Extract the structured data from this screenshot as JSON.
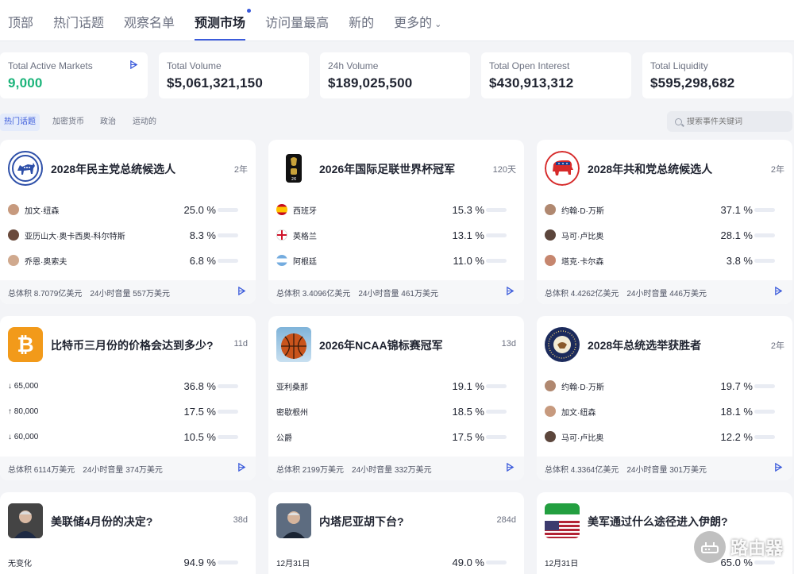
{
  "nav": {
    "tabs": [
      {
        "label": "顶部"
      },
      {
        "label": "热门话题"
      },
      {
        "label": "观察名单"
      },
      {
        "label": "预测市场",
        "active": true
      },
      {
        "label": "访问量最高"
      },
      {
        "label": "新的"
      },
      {
        "label": "更多的"
      }
    ],
    "more_icon": "chevron-down-icon"
  },
  "stats": [
    {
      "label": "Total Active Markets",
      "value": "9,000",
      "icon": "share-icon"
    },
    {
      "label": "Total Volume",
      "value": "$5,061,321,150"
    },
    {
      "label": "24h Volume",
      "value": "$189,025,500"
    },
    {
      "label": "Total Open Interest",
      "value": "$430,913,312"
    },
    {
      "label": "Total Liquidity",
      "value": "$595,298,682"
    }
  ],
  "filters": {
    "chips": [
      "热门话题",
      "加密货币",
      "政治",
      "运动的"
    ],
    "search_placeholder": "搜索事件关键词"
  },
  "colors": {
    "accent": "#3b5bdb",
    "green": "#1bb47a",
    "democrat": "#2d4fa8",
    "republican": "#d62a2a",
    "bitcoin": "#f29a1a"
  },
  "cards": [
    {
      "title": "2028年民主党总统候选人",
      "time": "2年",
      "icon": "donkey-icon",
      "rows": [
        {
          "name": "加文·纽森",
          "pct": "25.0 %",
          "value": 25.0
        },
        {
          "name": "亚历山大·奥卡西奥-科尔特斯",
          "pct": "8.3 %",
          "value": 8.3
        },
        {
          "name": "乔恩·奥索夫",
          "pct": "6.8 %",
          "value": 6.8
        }
      ],
      "foot": {
        "volume": "总体积 8.7079亿美元",
        "vol24": "24小时音量 557万美元"
      }
    },
    {
      "title": "2026年国际足联世界杯冠军",
      "time": "120天",
      "icon": "fifa-cup-icon",
      "rows": [
        {
          "name": "西班牙",
          "pct": "15.3 %",
          "value": 15.3
        },
        {
          "name": "英格兰",
          "pct": "13.1 %",
          "value": 13.1
        },
        {
          "name": "阿根廷",
          "pct": "11.0 %",
          "value": 11.0
        }
      ],
      "foot": {
        "volume": "总体积 3.4096亿美元",
        "vol24": "24小时音量 461万美元"
      }
    },
    {
      "title": "2028年共和党总统候选人",
      "time": "2年",
      "icon": "elephant-icon",
      "rows": [
        {
          "name": "约翰·D·万斯",
          "pct": "37.1 %",
          "value": 37.1
        },
        {
          "name": "马可·卢比奥",
          "pct": "28.1 %",
          "value": 28.1
        },
        {
          "name": "塔克·卡尔森",
          "pct": "3.8 %",
          "value": 3.8
        }
      ],
      "foot": {
        "volume": "总体积 4.4262亿美元",
        "vol24": "24小时音量 446万美元"
      }
    },
    {
      "title": "比特币三月份的价格会达到多少?",
      "time": "11d",
      "icon": "bitcoin-icon",
      "rows": [
        {
          "name": "↓ 65,000",
          "pct": "36.8 %",
          "value": 36.8
        },
        {
          "name": "↑ 80,000",
          "pct": "17.5 %",
          "value": 17.5
        },
        {
          "name": "↓ 60,000",
          "pct": "10.5 %",
          "value": 10.5
        }
      ],
      "foot": {
        "volume": "总体积 6114万美元",
        "vol24": "24小时音量 374万美元"
      }
    },
    {
      "title": "2026年NCAA锦标赛冠军",
      "time": "13d",
      "icon": "basketball-icon",
      "rows": [
        {
          "name": "亚利桑那",
          "pct": "19.1 %",
          "value": 19.1
        },
        {
          "name": "密歇根州",
          "pct": "18.5 %",
          "value": 18.5
        },
        {
          "name": "公爵",
          "pct": "17.5 %",
          "value": 17.5
        }
      ],
      "foot": {
        "volume": "总体积 2199万美元",
        "vol24": "24小时音量 332万美元"
      }
    },
    {
      "title": "2028年总统选举获胜者",
      "time": "2年",
      "icon": "presidential-seal-icon",
      "rows": [
        {
          "name": "约翰·D·万斯",
          "pct": "19.7 %",
          "value": 19.7
        },
        {
          "name": "加文·纽森",
          "pct": "18.1 %",
          "value": 18.1
        },
        {
          "name": "马可·卢比奥",
          "pct": "12.2 %",
          "value": 12.2
        }
      ],
      "foot": {
        "volume": "总体积 4.3364亿美元",
        "vol24": "24小时音量 301万美元"
      }
    },
    {
      "title": "美联储4月份的决定?",
      "time": "38d",
      "icon": "fed-chair-icon",
      "rows": [
        {
          "name": "无变化",
          "pct": "94.9 %",
          "value": 94.9
        }
      ]
    },
    {
      "title": "内塔尼亚胡下台?",
      "time": "284d",
      "icon": "netanyahu-icon",
      "rows": [
        {
          "name": "12月31日",
          "pct": "49.0 %",
          "value": 49.0
        }
      ]
    },
    {
      "title": "美军通过什么途径进入伊朗?",
      "time": "",
      "icon": "us-iran-flags-icon",
      "rows": [
        {
          "name": "12月31日",
          "pct": "65.0 %",
          "value": 65.0
        }
      ]
    }
  ],
  "watermark": {
    "text": "路由器"
  }
}
